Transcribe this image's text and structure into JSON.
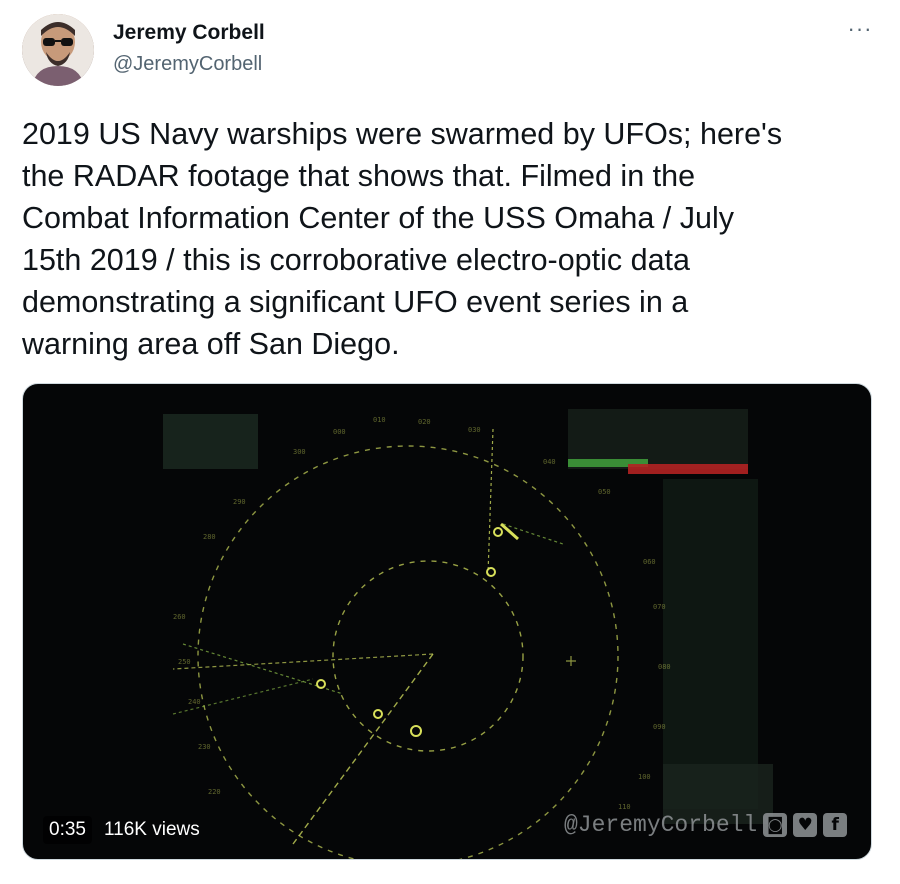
{
  "author": {
    "name": "Jeremy Corbell",
    "handle": "@JeremyCorbell",
    "avatar_icon": "profile-photo"
  },
  "more_icon": "more-horizontal-icon",
  "more_label": "···",
  "tweet": {
    "lines": [
      "2019 US Navy warships were swarmed by UFOs; here's",
      "the RADAR footage that shows that. Filmed in the",
      "Combat Information Center of the USS Omaha / July",
      "15th 2019 / this is corroborative electro-optic data",
      "demonstrating a significant UFO event series in a",
      "warning area off San Diego."
    ]
  },
  "video": {
    "duration": "0:35",
    "views": "116K views",
    "watermark": "@JeremyCorbell",
    "watermark_icons": [
      "instagram-icon",
      "twitter-icon",
      "facebook-icon"
    ],
    "radar_color": "#c8d45a",
    "background_color": "#050607"
  }
}
